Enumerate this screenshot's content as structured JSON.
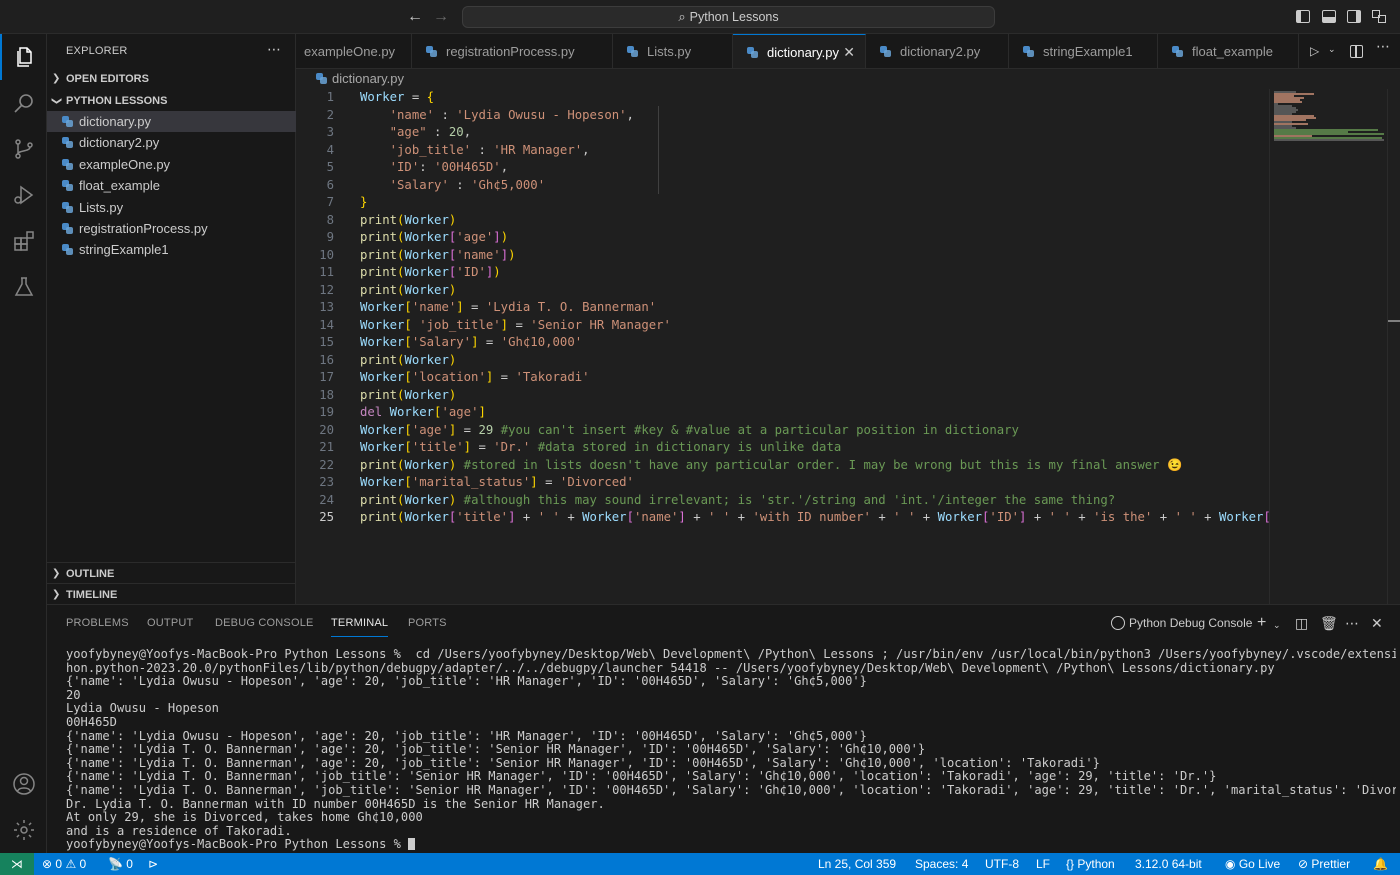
{
  "titlebar": {
    "search_label": "Python Lessons"
  },
  "sidebar": {
    "title": "EXPLORER",
    "sections": {
      "open_editors": "OPEN EDITORS",
      "folder": "PYTHON LESSONS",
      "outline": "OUTLINE",
      "timeline": "TIMELINE"
    },
    "files": [
      "dictionary.py",
      "dictionary2.py",
      "exampleOne.py",
      "float_example",
      "Lists.py",
      "registrationProcess.py",
      "stringExample1"
    ]
  },
  "tabs": [
    "exampleOne.py",
    "registrationProcess.py",
    "Lists.py",
    "dictionary.py",
    "dictionary2.py",
    "stringExample1",
    "float_example"
  ],
  "active_tab": "dictionary.py",
  "breadcrumb": "dictionary.py",
  "editor": {
    "line_numbers": [
      "1",
      "2",
      "3",
      "4",
      "5",
      "6",
      "7",
      "8",
      "9",
      "10",
      "11",
      "12",
      "13",
      "14",
      "15",
      "16",
      "17",
      "18",
      "19",
      "20",
      "21",
      "22",
      "23",
      "24",
      "25"
    ],
    "current_line": "25"
  },
  "panel": {
    "tabs": [
      "PROBLEMS",
      "OUTPUT",
      "DEBUG CONSOLE",
      "TERMINAL",
      "PORTS"
    ],
    "active_tab": "TERMINAL",
    "terminal_name": "Python Debug Console",
    "terminal_lines": [
      "yoofybyney@Yoofys-MacBook-Pro Python Lessons %  cd /Users/yoofybyney/Desktop/Web\\ Development\\ /Python\\ Lessons ; /usr/bin/env /usr/local/bin/python3 /Users/yoofybyney/.vscode/extensions/ms-pyt",
      "hon.python-2023.20.0/pythonFiles/lib/python/debugpy/adapter/../../debugpy/launcher 54418 -- /Users/yoofybyney/Desktop/Web\\ Development\\ /Python\\ Lessons/dictionary.py",
      "{'name': 'Lydia Owusu - Hopeson', 'age': 20, 'job_title': 'HR Manager', 'ID': '00H465D', 'Salary': 'Gh¢5,000'}",
      "20",
      "Lydia Owusu - Hopeson",
      "00H465D",
      "{'name': 'Lydia Owusu - Hopeson', 'age': 20, 'job_title': 'HR Manager', 'ID': '00H465D', 'Salary': 'Gh¢5,000'}",
      "{'name': 'Lydia T. O. Bannerman', 'age': 20, 'job_title': 'Senior HR Manager', 'ID': '00H465D', 'Salary': 'Gh¢10,000'}",
      "{'name': 'Lydia T. O. Bannerman', 'age': 20, 'job_title': 'Senior HR Manager', 'ID': '00H465D', 'Salary': 'Gh¢10,000', 'location': 'Takoradi'}",
      "{'name': 'Lydia T. O. Bannerman', 'job_title': 'Senior HR Manager', 'ID': '00H465D', 'Salary': 'Gh¢10,000', 'location': 'Takoradi', 'age': 29, 'title': 'Dr.'}",
      "{'name': 'Lydia T. O. Bannerman', 'job_title': 'Senior HR Manager', 'ID': '00H465D', 'Salary': 'Gh¢10,000', 'location': 'Takoradi', 'age': 29, 'title': 'Dr.', 'marital_status': 'Divorced'}",
      "Dr. Lydia T. O. Bannerman with ID number 00H465D is the Senior HR Manager.",
      "At only 29, she is Divorced, takes home Gh¢10,000",
      "and is a residence of Takoradi."
    ],
    "prompt": "yoofybyney@Yoofys-MacBook-Pro Python Lessons % "
  },
  "statusbar": {
    "errors": "0",
    "warnings": "0",
    "ports": "0",
    "position": "Ln 25, Col 359",
    "spaces": "Spaces: 4",
    "encoding": "UTF-8",
    "eol": "LF",
    "language": "Python",
    "interpreter": "3.12.0 64-bit",
    "go_live": "Go Live",
    "prettier": "Prettier"
  },
  "colors": {
    "accent": "#0078d4",
    "statusbar": "#0078d4",
    "remote": "#16825d"
  }
}
